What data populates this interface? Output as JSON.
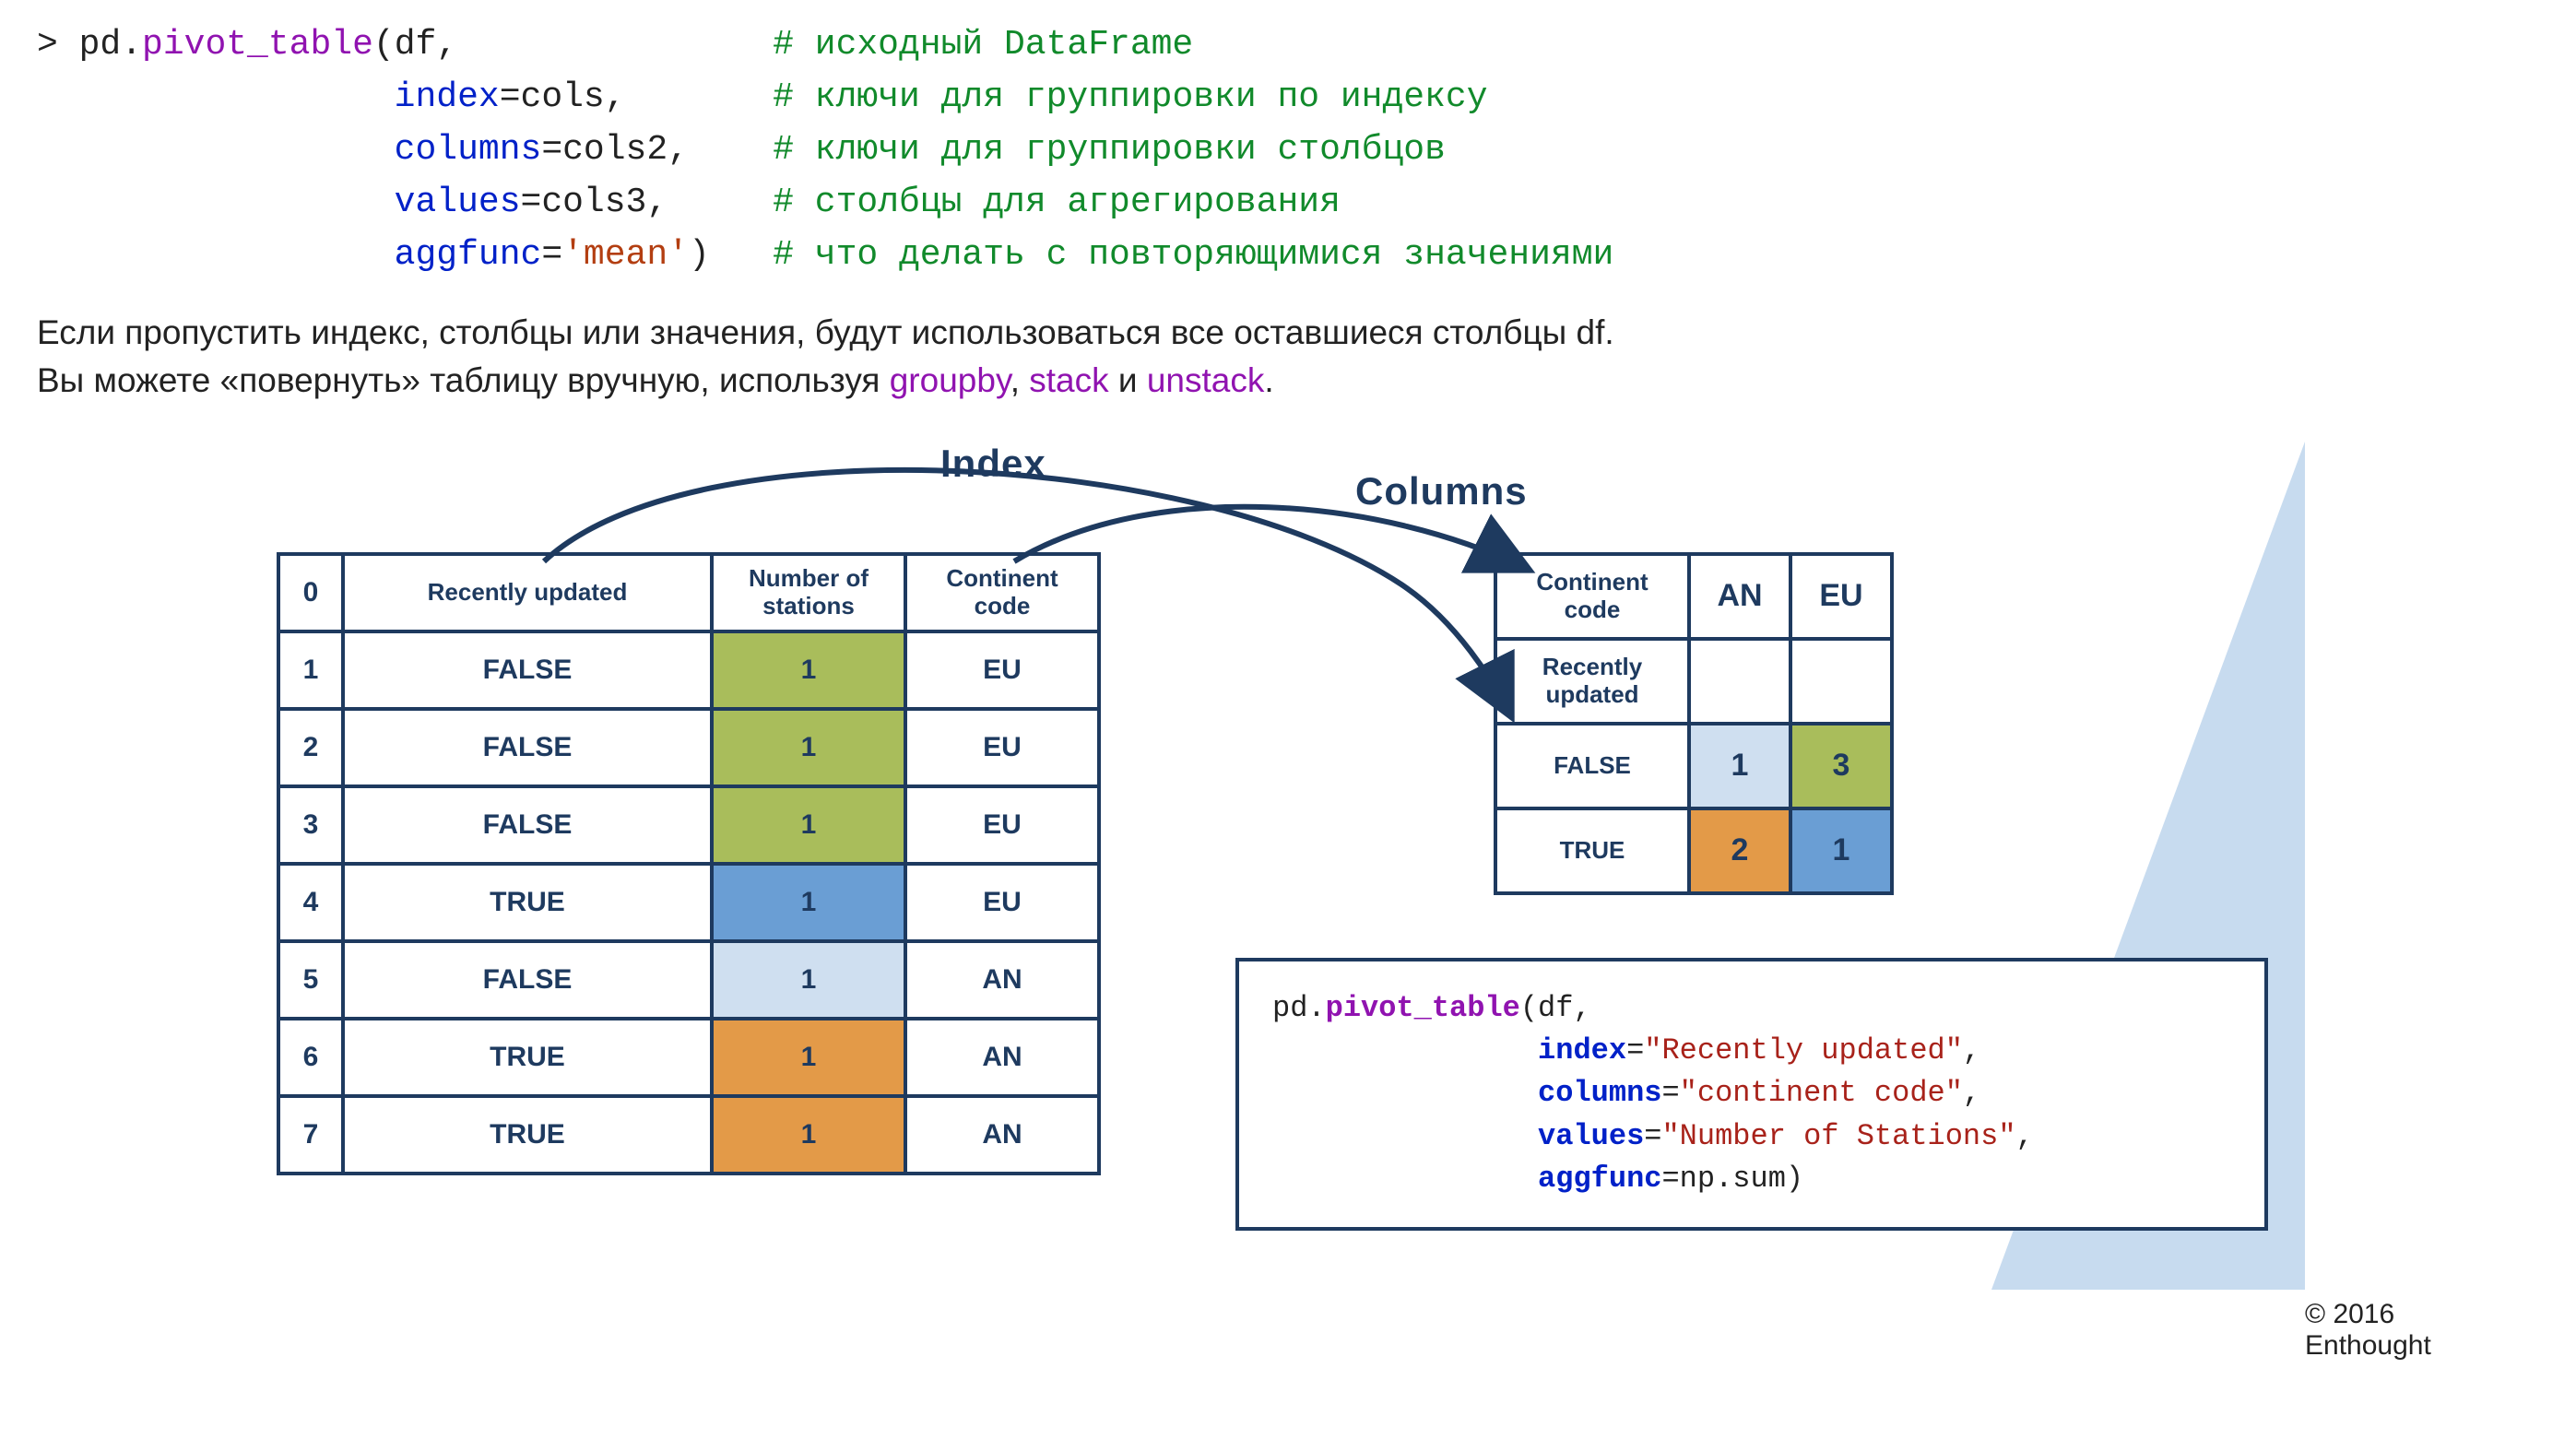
{
  "code": {
    "prompt": "> ",
    "fn_obj": "pd",
    "fn_name": "pivot_table",
    "arg0": "df",
    "arg0_comment": "# исходный DataFrame",
    "kw_index": "index",
    "val_index": "cols",
    "c_index": "# ключи для группировки по индексу",
    "kw_columns": "columns",
    "val_columns": "cols2",
    "c_columns": "# ключи для группировки столбцов",
    "kw_values": "values",
    "val_values": "cols3",
    "c_values": "# столбцы для агрегирования",
    "kw_agg": "aggfunc",
    "val_agg": "'mean'",
    "c_agg": "# что делать с повторяющимися значениями"
  },
  "body": {
    "line1a": "Если пропустить индекс, столбцы или значения, будут использоваться все оставшиеся столбцы df.",
    "line2a": "Вы можете «повернуть» таблицу вручную, используя ",
    "link1": "groupby",
    "sep1": ", ",
    "link2": "stack",
    "sep2": " и ",
    "link3": "unstack",
    "dot": "."
  },
  "labels": {
    "index": "Index",
    "columns": "Columns"
  },
  "src": {
    "h0": "0",
    "h1": "Recently updated",
    "h2_l1": "Number of",
    "h2_l2": "stations",
    "h3_l1": "Continent",
    "h3_l2": "code",
    "rows": [
      {
        "idx": "1",
        "ru": "FALSE",
        "ns": "1",
        "cc": "EU",
        "cls": "cell-olive"
      },
      {
        "idx": "2",
        "ru": "FALSE",
        "ns": "1",
        "cc": "EU",
        "cls": "cell-olive"
      },
      {
        "idx": "3",
        "ru": "FALSE",
        "ns": "1",
        "cc": "EU",
        "cls": "cell-olive"
      },
      {
        "idx": "4",
        "ru": "TRUE",
        "ns": "1",
        "cc": "EU",
        "cls": "cell-bluemd"
      },
      {
        "idx": "5",
        "ru": "FALSE",
        "ns": "1",
        "cc": "AN",
        "cls": "cell-bluelt"
      },
      {
        "idx": "6",
        "ru": "TRUE",
        "ns": "1",
        "cc": "AN",
        "cls": "cell-orange"
      },
      {
        "idx": "7",
        "ru": "TRUE",
        "ns": "1",
        "cc": "AN",
        "cls": "cell-orange"
      }
    ]
  },
  "pvt": {
    "h_cont_l1": "Continent",
    "h_cont_l2": "code",
    "h_an": "AN",
    "h_eu": "EU",
    "h_ru_l1": "Recently",
    "h_ru_l2": "updated",
    "r1_lbl": "FALSE",
    "r1_an": "1",
    "r1_eu": "3",
    "r2_lbl": "TRUE",
    "r2_an": "2",
    "r2_eu": "1"
  },
  "example": {
    "l1a": "pd.",
    "l1b": "pivot_table",
    "l1c": "(df,",
    "l2a": "               ",
    "l2b_kw": "index",
    "l2b_eq": "=",
    "l2b_str": "\"Recently updated\"",
    "l2b_c": ",",
    "l3a": "               ",
    "l3b_kw": "columns",
    "l3b_eq": "=",
    "l3b_str": "\"continent code\"",
    "l3b_c": ",",
    "l4a": "               ",
    "l4b_kw": "values",
    "l4b_eq": "=",
    "l4b_str": "\"Number of Stations\"",
    "l4b_c": ",",
    "l5a": "               ",
    "l5b_kw": "aggfunc",
    "l5b_eq": "=np.sum)"
  },
  "copyright": "© 2016 Enthought"
}
